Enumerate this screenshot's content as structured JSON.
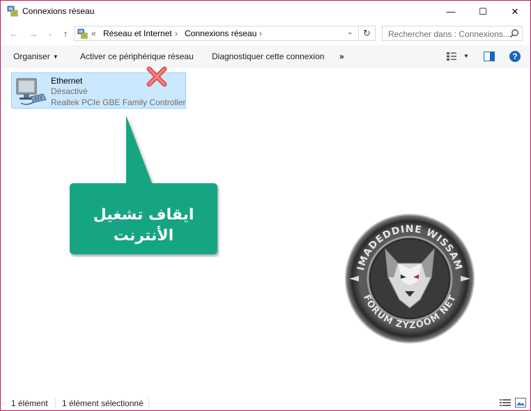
{
  "window": {
    "title": "Connexions réseau",
    "minimize_glyph": "—",
    "maximize_glyph": "☐",
    "close_glyph": "✕"
  },
  "navigation": {
    "back_glyph": "←",
    "forward_glyph": "→",
    "history_glyph": "⌄",
    "up_glyph": "↑",
    "address": {
      "overflow": "«",
      "segments": [
        "Réseau et Internet",
        "Connexions réseau"
      ],
      "separator": "›",
      "dropdown_glyph": "⌄"
    },
    "refresh_glyph": "↻",
    "search_placeholder": "Rechercher dans : Connexions..."
  },
  "commands": {
    "organiser": "Organiser",
    "activate": "Activer ce périphérique réseau",
    "diagnose": "Diagnostiquer cette connexion",
    "more": "»",
    "help_glyph": "?"
  },
  "connections": [
    {
      "name": "Ethernet",
      "status": "Désactivé",
      "adapter": "Realtek PCIe GBE Family Controller",
      "selected": true,
      "disabled_marker_color": "#e05252"
    }
  ],
  "annotation": {
    "lines": [
      "ايقاف تشغيل",
      "الأنترنت"
    ],
    "fill_color": "#12a583"
  },
  "watermark": {
    "top_text": "IMADEDDINE WISSAM",
    "bottom_text": "FORUM ZYZOOM NET"
  },
  "status": {
    "item_count": "1 élément",
    "selected_count": "1 élément sélectionné"
  },
  "colors": {
    "selection_bg": "#cce8ff",
    "selection_border": "#99d1ff",
    "window_border": "#c2185b",
    "help_blue": "#1966c2"
  }
}
